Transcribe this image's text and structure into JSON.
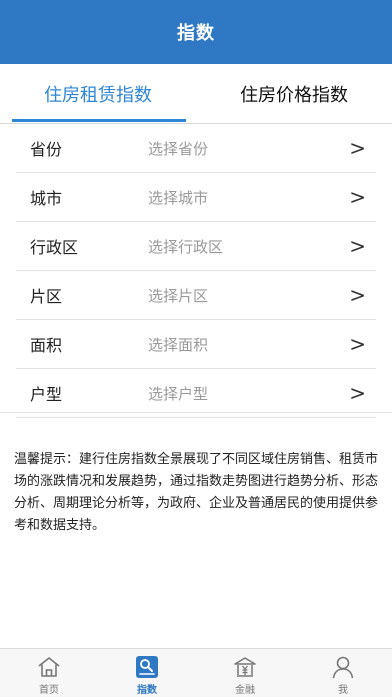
{
  "header": {
    "title": "指数"
  },
  "tabs": [
    {
      "label": "住房租赁指数",
      "active": true
    },
    {
      "label": "住房价格指数",
      "active": false
    }
  ],
  "form": {
    "rows": [
      {
        "label": "省份",
        "placeholder": "选择省份",
        "arrow": ">"
      },
      {
        "label": "城市",
        "placeholder": "选择城市",
        "arrow": ">"
      },
      {
        "label": "行政区",
        "placeholder": "选择行政区",
        "arrow": ">"
      },
      {
        "label": "片区",
        "placeholder": "选择片区",
        "arrow": ">"
      },
      {
        "label": "面积",
        "placeholder": "选择面积",
        "arrow": ">"
      },
      {
        "label": "户型",
        "placeholder": "选择户型",
        "arrow": ">"
      }
    ]
  },
  "tip": {
    "text": "温馨提示：建行住房指数全景展现了不同区域住房销售、租赁市场的涨跌情况和发展趋势，通过指数走势图进行趋势分析、形态分析、周期理论分析等，为政府、企业及普通居民的使用提供参考和数据支持。"
  },
  "tabbar": {
    "items": [
      {
        "label": "首页",
        "icon": "home-icon",
        "active": false
      },
      {
        "label": "指数",
        "icon": "index-icon",
        "active": true
      },
      {
        "label": "金融",
        "icon": "finance-icon",
        "active": false
      },
      {
        "label": "我",
        "icon": "user-icon",
        "active": false
      }
    ]
  },
  "colors": {
    "primary": "#2f78c3",
    "tab_active": "#2f86d4",
    "placeholder": "#9a9a9a"
  }
}
